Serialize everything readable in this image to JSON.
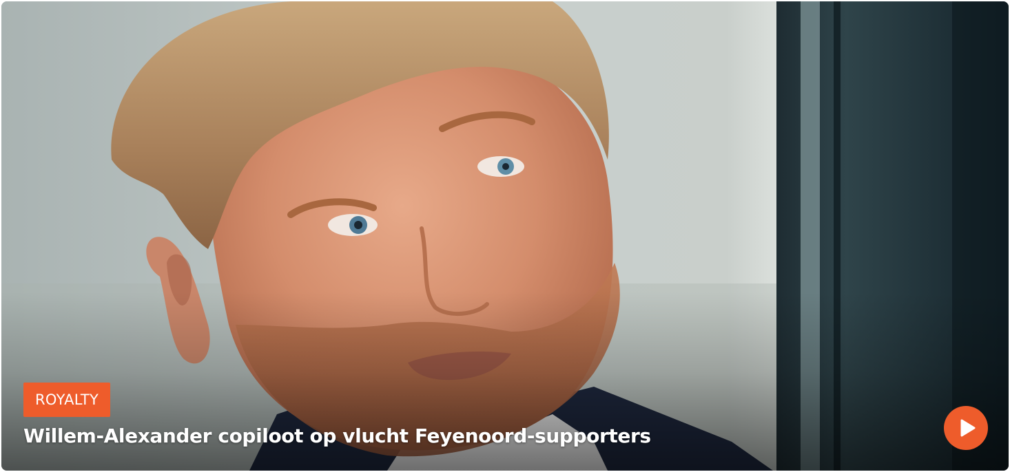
{
  "article": {
    "category": "ROYALTY",
    "headline": "Willem-Alexander copiloot op vlucht Feyenoord-supporters",
    "image_subject": "portrait-photo",
    "has_video": true
  },
  "colors": {
    "accent": "#ee5c2b",
    "text_on_image": "#ffffff"
  },
  "icons": {
    "play": "play-icon"
  }
}
